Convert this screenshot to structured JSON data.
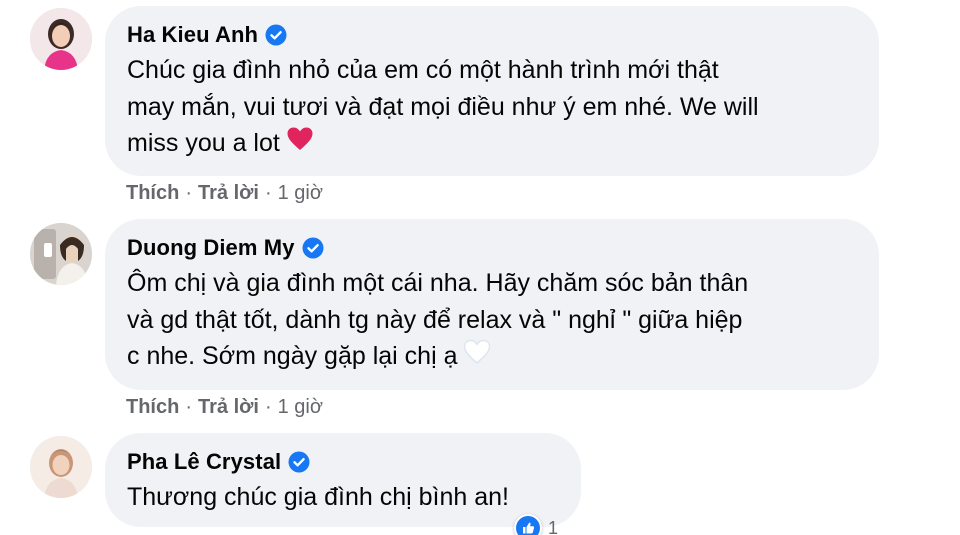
{
  "colors": {
    "bubble": "#f0f2f5",
    "verified": "#1877f2",
    "meta": "#65676b",
    "heart": "#e0245e"
  },
  "comments": [
    {
      "author": "Ha Kieu Anh",
      "verified": true,
      "lines": [
        "Chúc gia đình nhỏ của em có một hành trình mới thật",
        "may mắn, vui tươi và đạt mọi điều như ý em nhé. We will",
        "miss you a lot"
      ],
      "emoji": "red-heart",
      "like_label": "Thích",
      "reply_label": "Trả lời",
      "separator": "·",
      "time": "1 giờ"
    },
    {
      "author": "Duong Diem My",
      "verified": true,
      "lines": [
        "Ôm chị và gia đình một cái nha. Hãy chăm sóc bản thân",
        "và gd thật tốt, dành tg này để relax và \" nghỉ \" giữa hiệp",
        "c nhe. Sớm ngày gặp lại chị ạ"
      ],
      "emoji": "white-heart",
      "like_label": "Thích",
      "reply_label": "Trả lời",
      "separator": "·",
      "time": "1 giờ"
    },
    {
      "author": "Pha Lê Crystal",
      "verified": true,
      "lines": [
        "Thương chúc gia đình chị bình an!"
      ],
      "reaction_icon": "like-icon",
      "reaction_count": "1"
    }
  ]
}
